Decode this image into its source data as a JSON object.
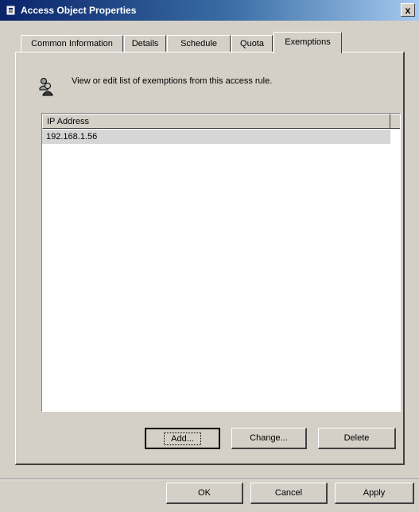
{
  "window": {
    "title": "Access Object Properties",
    "close_label": "x"
  },
  "tabs": [
    {
      "label": "Common Information"
    },
    {
      "label": "Details"
    },
    {
      "label": "Schedule"
    },
    {
      "label": "Quota"
    },
    {
      "label": "Exemptions",
      "active": true
    }
  ],
  "panel": {
    "description": "View or edit list of exemptions from this access rule.",
    "icon": "users-icon",
    "list": {
      "columns": [
        "IP Address"
      ],
      "rows": [
        {
          "ip": "192.168.1.56",
          "selected": true
        }
      ]
    },
    "buttons": {
      "add": "Add...",
      "change": "Change...",
      "delete": "Delete"
    }
  },
  "footer": {
    "ok": "OK",
    "cancel": "Cancel",
    "apply": "Apply"
  },
  "colors": {
    "titlebar_start": "#0a246a",
    "titlebar_end": "#a6caf0",
    "face": "#d4d0c8"
  }
}
